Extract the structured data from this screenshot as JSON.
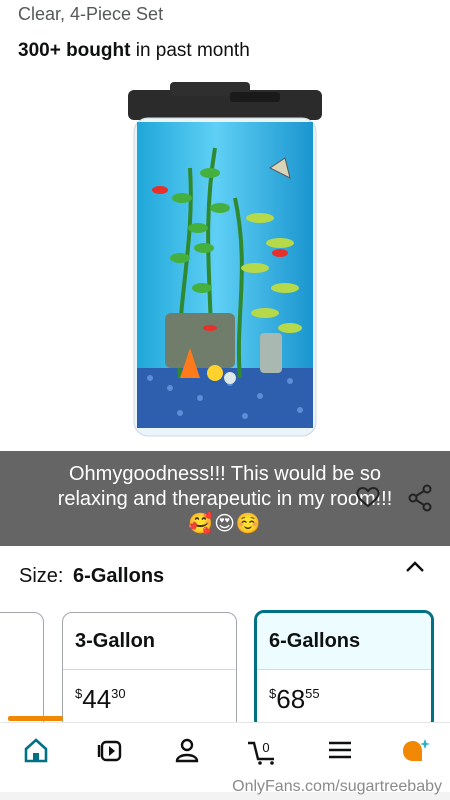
{
  "header": {
    "subtitle": "Clear, 4-Piece Set",
    "bought_bold": "300+ bought",
    "bought_rest": " in past month"
  },
  "caption": {
    "line1": "Ohmygoodness!!! This would be so",
    "line2": "relaxing and therapeutic in my room!!!",
    "emoji": "🥰😍☺️"
  },
  "size": {
    "label": "Size:",
    "selected": "6-Gallons"
  },
  "options": [
    {
      "name": "3-Gallon",
      "currency": "$",
      "whole": "44",
      "fraction": "30"
    },
    {
      "name": "6-Gallons",
      "currency": "$",
      "whole": "68",
      "fraction": "55"
    }
  ],
  "nav": {
    "items": [
      "home-icon",
      "video-icon",
      "account-icon",
      "cart-icon",
      "menu-icon",
      "assistant-icon"
    ],
    "cart_count": "0"
  },
  "watermark": "OnlyFans.com/sugartreebaby",
  "colors": {
    "accent_teal": "#007185",
    "orange": "#f08804",
    "text": "#0f1111"
  }
}
